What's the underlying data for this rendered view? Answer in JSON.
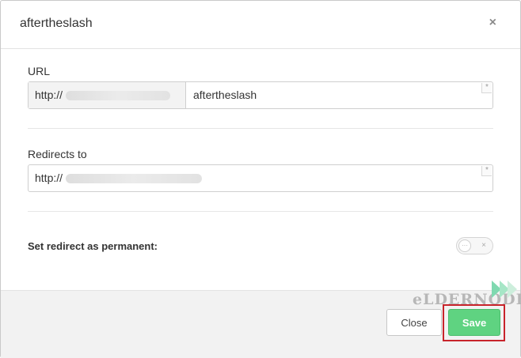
{
  "modal": {
    "title": "aftertheslash",
    "close_icon": "close-x-icon"
  },
  "form": {
    "url": {
      "label": "URL",
      "prefix": "http://",
      "value": "aftertheslash",
      "required_marker": "*"
    },
    "redirect": {
      "label": "Redirects to",
      "value": "http://",
      "required_marker": "*"
    },
    "permanent": {
      "label": "Set redirect as permanent:",
      "state": "off",
      "off_glyph": "×"
    }
  },
  "footer": {
    "close_label": "Close",
    "save_label": "Save"
  },
  "watermark": {
    "text": "eLDERNODE"
  },
  "colors": {
    "save_bg": "#5fd381",
    "highlight": "#c8242b",
    "watermark": "#b7b7b7"
  }
}
